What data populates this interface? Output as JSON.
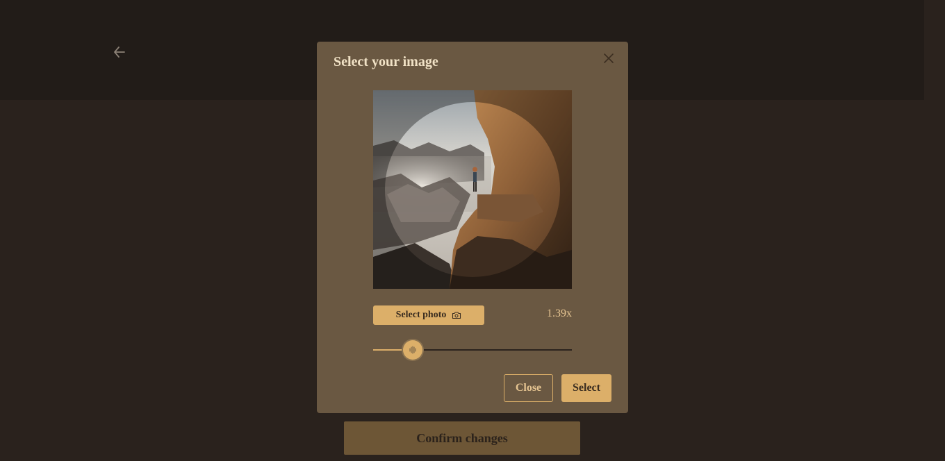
{
  "header": {
    "back_icon": "arrow-left-icon"
  },
  "modal": {
    "title": "Select your image",
    "close_icon": "close-icon",
    "image_alt": "Hiker standing on a rock ledge overlooking misty canyons",
    "select_photo_label": "Select photo",
    "camera_icon": "camera-icon",
    "zoom_label": "1.39x",
    "zoom_slider_fraction": 0.2,
    "close_button_label": "Close",
    "select_button_label": "Select"
  },
  "footer": {
    "confirm_label": "Confirm changes"
  },
  "colors": {
    "background": "#2a221d",
    "topbar": "#221c18",
    "modal_bg": "#6a5842",
    "accent": "#dcaf69",
    "confirm_disabled": "#6d5636",
    "title_text": "#f1e2c6"
  }
}
